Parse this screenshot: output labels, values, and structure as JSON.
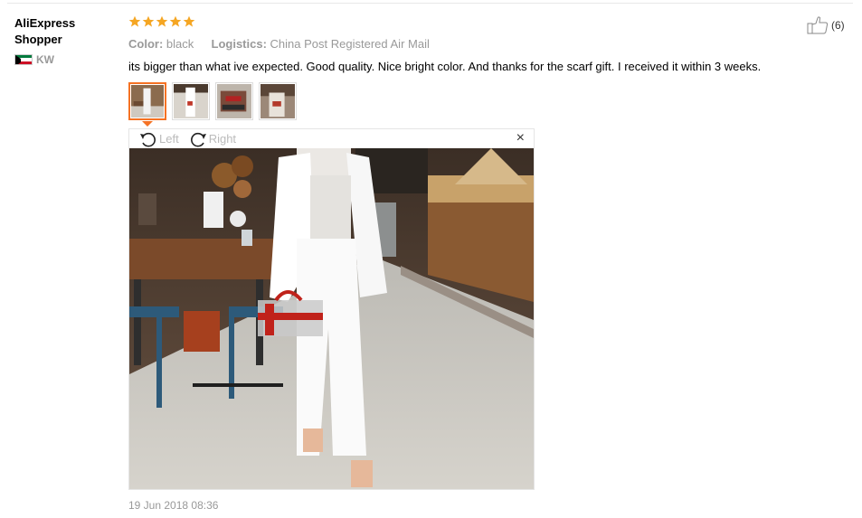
{
  "reviewer": {
    "name": "AliExpress Shopper",
    "country_code": "KW"
  },
  "review": {
    "rating": 5,
    "rating_max": 5,
    "color_label": "Color:",
    "color_value": "black",
    "logistics_label": "Logistics:",
    "logistics_value": "China Post Registered Air Mail",
    "text": "its bigger than what ive expected. Good quality. Nice bright color. And thanks for the scarf gift. I received it within 3 weeks.",
    "date": "19 Jun 2018 08:36",
    "helpful_count": "(6)"
  },
  "viewer": {
    "rotate_left_label": "Left",
    "rotate_right_label": "Right",
    "close_symbol": "×"
  },
  "thumbnails": [
    {
      "name": "photo-1",
      "selected": true
    },
    {
      "name": "photo-2",
      "selected": false
    },
    {
      "name": "photo-3",
      "selected": false
    },
    {
      "name": "photo-4",
      "selected": false
    }
  ],
  "colors": {
    "star": "#f5a623",
    "accent": "#f57224"
  },
  "icons": {
    "thumbs_up": "thumbs-up-icon",
    "rotate_left": "rotate-left-icon",
    "rotate_right": "rotate-right-icon",
    "close": "close-icon",
    "flag": "kuwait-flag-icon"
  }
}
